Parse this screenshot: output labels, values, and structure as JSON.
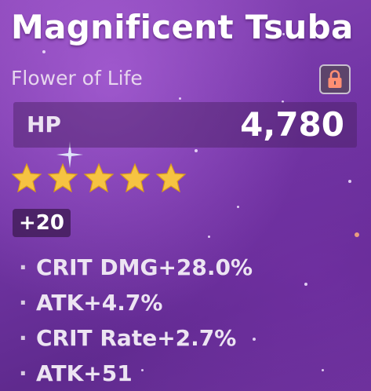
{
  "artifact": {
    "name": "Magnificent Tsuba",
    "slot": "Flower of Life",
    "main_stat": {
      "label": "HP",
      "value": "4,780"
    },
    "rarity_stars": 5,
    "level": "+20",
    "substats": [
      {
        "text": "CRIT DMG+28.0%"
      },
      {
        "text": "ATK+4.7%"
      },
      {
        "text": "CRIT Rate+2.7%"
      },
      {
        "text": "ATK+51"
      }
    ],
    "bullet": "·"
  },
  "icons": {
    "lock": "lock-icon",
    "star": "star-icon"
  },
  "colors": {
    "star": "#f6c342",
    "lock": "#ff8f73"
  }
}
